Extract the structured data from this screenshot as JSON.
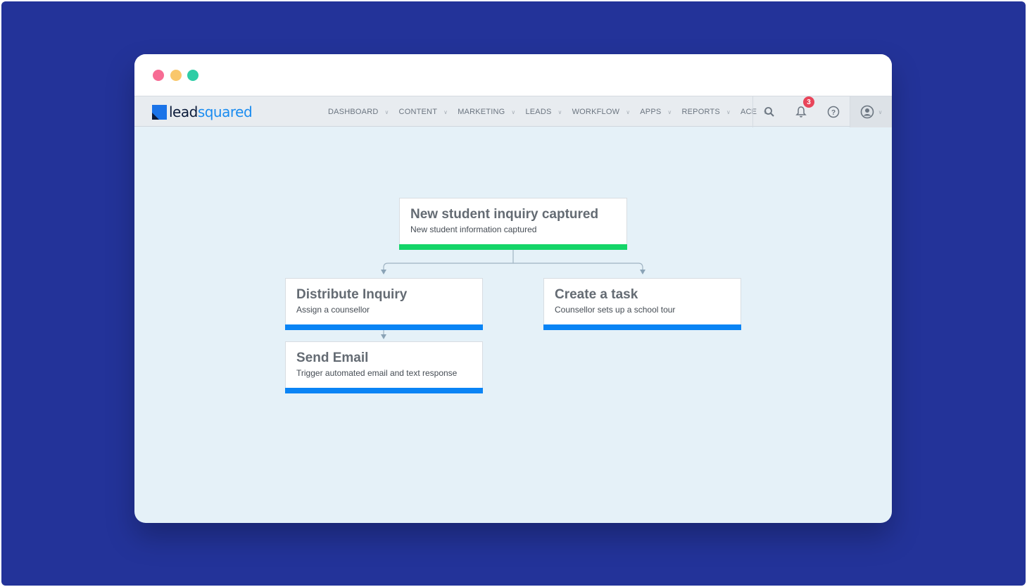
{
  "brand": {
    "logo_part1": "lead",
    "logo_part2": "squared",
    "accent": "#1a8cf0",
    "backdrop": "#233399"
  },
  "nav": {
    "items": [
      "DASHBOARD",
      "CONTENT",
      "MARKETING",
      "LEADS",
      "WORKFLOW",
      "APPS",
      "REPORTS",
      "ACE"
    ],
    "notification_count": "3"
  },
  "workflow": {
    "root": {
      "title": "New student inquiry captured",
      "subtitle": "New student information captured",
      "bar_color": "#14d568"
    },
    "left": {
      "title": "Distribute Inquiry",
      "subtitle": "Assign a counsellor",
      "bar_color": "#0a84f5"
    },
    "right": {
      "title": "Create a task",
      "subtitle": "Counsellor sets up a school tour",
      "bar_color": "#0a84f5"
    },
    "bottom": {
      "title": "Send Email",
      "subtitle": "Trigger automated email and text response",
      "bar_color": "#0a84f5"
    }
  }
}
